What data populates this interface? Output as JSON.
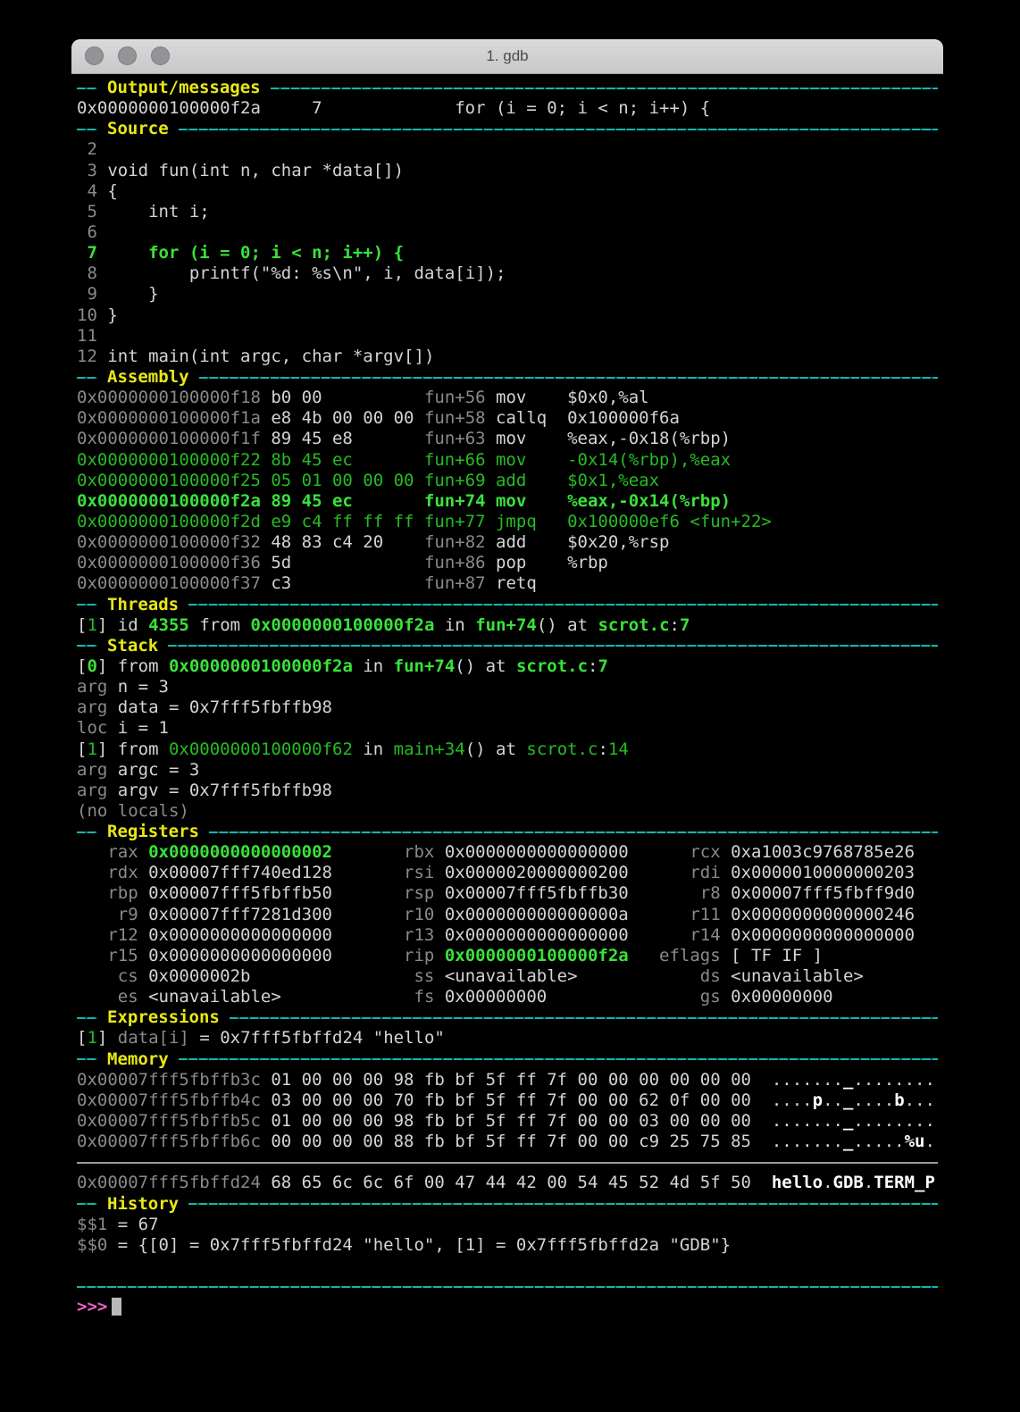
{
  "window": {
    "title": "1. gdb",
    "traffic_lights": [
      "close",
      "minimize",
      "zoom"
    ]
  },
  "colors": {
    "divider_cyan": "#14b5b0",
    "section_label_yellow": "#e8e815",
    "highlight_green": "#3ae23a",
    "green": "#25bc24",
    "dim_gray": "#8a8a8a",
    "text_white": "#d4d4d4",
    "prompt_magenta": "#ee63c8",
    "cursor_gray": "#b9b9b9",
    "memory_divider_gray": "#9c9c9c"
  },
  "terminal": {
    "prompt": ">>>",
    "lines": [
      {
        "type": "header",
        "name": "section-output-messages",
        "label": "Output/messages"
      },
      {
        "type": "text",
        "name": "output-line",
        "seg": [
          [
            "w",
            "0x0000000100000f2a     7             for (i = 0; i < n; i++) {"
          ]
        ]
      },
      {
        "type": "header",
        "name": "section-source",
        "label": "Source"
      },
      {
        "type": "text",
        "name": "source-line-2",
        "seg": [
          [
            "d",
            " 2"
          ]
        ]
      },
      {
        "type": "text",
        "name": "source-line-3",
        "seg": [
          [
            "d",
            " 3"
          ],
          [
            "w",
            " void fun(int n, char *data[])"
          ]
        ]
      },
      {
        "type": "text",
        "name": "source-line-4",
        "seg": [
          [
            "d",
            " 4"
          ],
          [
            "w",
            " {"
          ]
        ]
      },
      {
        "type": "text",
        "name": "source-line-5",
        "seg": [
          [
            "d",
            " 5"
          ],
          [
            "w",
            "     int i;"
          ]
        ]
      },
      {
        "type": "text",
        "name": "source-line-6",
        "seg": [
          [
            "d",
            " 6"
          ]
        ]
      },
      {
        "type": "text",
        "name": "source-line-7-current",
        "seg": [
          [
            "G",
            " 7     for (i = 0; i < n; i++) {"
          ]
        ]
      },
      {
        "type": "text",
        "name": "source-line-8",
        "seg": [
          [
            "d",
            " 8"
          ],
          [
            "w",
            "         printf(\"%d: %s\\n\", i, data[i]);"
          ]
        ]
      },
      {
        "type": "text",
        "name": "source-line-9",
        "seg": [
          [
            "d",
            " 9"
          ],
          [
            "w",
            "     }"
          ]
        ]
      },
      {
        "type": "text",
        "name": "source-line-10",
        "seg": [
          [
            "d",
            "10"
          ],
          [
            "w",
            " }"
          ]
        ]
      },
      {
        "type": "text",
        "name": "source-line-11",
        "seg": [
          [
            "d",
            "11"
          ]
        ]
      },
      {
        "type": "text",
        "name": "source-line-12",
        "seg": [
          [
            "d",
            "12"
          ],
          [
            "w",
            " int main(int argc, char *argv[])"
          ]
        ]
      },
      {
        "type": "header",
        "name": "section-assembly",
        "label": "Assembly"
      },
      {
        "type": "text",
        "name": "asm-line-fun56",
        "seg": [
          [
            "d",
            "0x0000000100000f18"
          ],
          [
            "w",
            " b0 00          "
          ],
          [
            "d",
            "fun+56"
          ],
          [
            "w",
            " mov    $0x0,%al"
          ]
        ]
      },
      {
        "type": "text",
        "name": "asm-line-fun58",
        "seg": [
          [
            "d",
            "0x0000000100000f1a"
          ],
          [
            "w",
            " e8 4b 00 00 00 "
          ],
          [
            "d",
            "fun+58"
          ],
          [
            "w",
            " callq  0x100000f6a"
          ]
        ]
      },
      {
        "type": "text",
        "name": "asm-line-fun63",
        "seg": [
          [
            "d",
            "0x0000000100000f1f"
          ],
          [
            "w",
            " 89 45 e8       "
          ],
          [
            "d",
            "fun+63"
          ],
          [
            "w",
            " mov    %eax,-0x18(%rbp)"
          ]
        ]
      },
      {
        "type": "text",
        "name": "asm-line-fun66",
        "seg": [
          [
            "g",
            "0x0000000100000f22 8b 45 ec       fun+66 mov    -0x14(%rbp),%eax"
          ]
        ]
      },
      {
        "type": "text",
        "name": "asm-line-fun69",
        "seg": [
          [
            "g",
            "0x0000000100000f25 05 01 00 00 00 fun+69 add    $0x1,%eax"
          ]
        ]
      },
      {
        "type": "text",
        "name": "asm-line-fun74-current",
        "seg": [
          [
            "G",
            "0x0000000100000f2a 89 45 ec       fun+74 mov    %eax,-0x14(%rbp)"
          ]
        ]
      },
      {
        "type": "text",
        "name": "asm-line-fun77",
        "seg": [
          [
            "g",
            "0x0000000100000f2d e9 c4 ff ff ff fun+77 jmpq   0x100000ef6 <fun+22>"
          ]
        ]
      },
      {
        "type": "text",
        "name": "asm-line-fun82",
        "seg": [
          [
            "d",
            "0x0000000100000f32"
          ],
          [
            "w",
            " 48 83 c4 20    "
          ],
          [
            "d",
            "fun+82"
          ],
          [
            "w",
            " add    $0x20,%rsp"
          ]
        ]
      },
      {
        "type": "text",
        "name": "asm-line-fun86",
        "seg": [
          [
            "d",
            "0x0000000100000f36"
          ],
          [
            "w",
            " 5d             "
          ],
          [
            "d",
            "fun+86"
          ],
          [
            "w",
            " pop    %rbp"
          ]
        ]
      },
      {
        "type": "text",
        "name": "asm-line-fun87",
        "seg": [
          [
            "d",
            "0x0000000100000f37"
          ],
          [
            "w",
            " c3             "
          ],
          [
            "d",
            "fun+87"
          ],
          [
            "w",
            " retq"
          ]
        ]
      },
      {
        "type": "header",
        "name": "section-threads",
        "label": "Threads"
      },
      {
        "type": "text",
        "name": "thread-1",
        "seg": [
          [
            "w",
            "["
          ],
          [
            "g",
            "1"
          ],
          [
            "w",
            "] id "
          ],
          [
            "G",
            "4355"
          ],
          [
            "w",
            " from "
          ],
          [
            "G",
            "0x0000000100000f2a"
          ],
          [
            "w",
            " in "
          ],
          [
            "G",
            "fun+74"
          ],
          [
            "w",
            "() at "
          ],
          [
            "G",
            "scrot.c"
          ],
          [
            "w",
            ":"
          ],
          [
            "G",
            "7"
          ]
        ]
      },
      {
        "type": "header",
        "name": "section-stack",
        "label": "Stack"
      },
      {
        "type": "text",
        "name": "stack-frame-0",
        "seg": [
          [
            "w",
            "["
          ],
          [
            "G",
            "0"
          ],
          [
            "w",
            "] from "
          ],
          [
            "G",
            "0x0000000100000f2a"
          ],
          [
            "w",
            " in "
          ],
          [
            "G",
            "fun+74"
          ],
          [
            "w",
            "() at "
          ],
          [
            "G",
            "scrot.c"
          ],
          [
            "w",
            ":"
          ],
          [
            "G",
            "7"
          ]
        ]
      },
      {
        "type": "text",
        "name": "stack-arg-n",
        "seg": [
          [
            "d",
            "arg"
          ],
          [
            "w",
            " n = 3"
          ]
        ]
      },
      {
        "type": "text",
        "name": "stack-arg-data",
        "seg": [
          [
            "d",
            "arg"
          ],
          [
            "w",
            " data = 0x7fff5fbffb98"
          ]
        ]
      },
      {
        "type": "text",
        "name": "stack-loc-i",
        "seg": [
          [
            "d",
            "loc"
          ],
          [
            "w",
            " i = 1"
          ]
        ]
      },
      {
        "type": "text",
        "name": "stack-frame-1",
        "seg": [
          [
            "w",
            "["
          ],
          [
            "g",
            "1"
          ],
          [
            "w",
            "] from "
          ],
          [
            "g",
            "0x0000000100000f62"
          ],
          [
            "w",
            " in "
          ],
          [
            "g",
            "main+34"
          ],
          [
            "w",
            "() at "
          ],
          [
            "g",
            "scrot.c"
          ],
          [
            "w",
            ":"
          ],
          [
            "g",
            "14"
          ]
        ]
      },
      {
        "type": "text",
        "name": "stack-arg-argc",
        "seg": [
          [
            "d",
            "arg"
          ],
          [
            "w",
            " argc = 3"
          ]
        ]
      },
      {
        "type": "text",
        "name": "stack-arg-argv",
        "seg": [
          [
            "d",
            "arg"
          ],
          [
            "w",
            " argv = 0x7fff5fbffb98"
          ]
        ]
      },
      {
        "type": "text",
        "name": "stack-no-locals",
        "seg": [
          [
            "d",
            "(no locals)"
          ]
        ]
      },
      {
        "type": "header",
        "name": "section-registers",
        "label": "Registers"
      },
      {
        "type": "text",
        "name": "reg-row-1",
        "seg": [
          [
            "d",
            "   rax "
          ],
          [
            "G",
            "0x0000000000000002"
          ],
          [
            "d",
            "       rbx "
          ],
          [
            "w",
            "0x0000000000000000"
          ],
          [
            "d",
            "      rcx "
          ],
          [
            "w",
            "0xa1003c9768785e26"
          ]
        ]
      },
      {
        "type": "text",
        "name": "reg-row-2",
        "seg": [
          [
            "d",
            "   rdx "
          ],
          [
            "w",
            "0x00007fff740ed128"
          ],
          [
            "d",
            "       rsi "
          ],
          [
            "w",
            "0x0000020000000200"
          ],
          [
            "d",
            "      rdi "
          ],
          [
            "w",
            "0x0000010000000203"
          ]
        ]
      },
      {
        "type": "text",
        "name": "reg-row-3",
        "seg": [
          [
            "d",
            "   rbp "
          ],
          [
            "w",
            "0x00007fff5fbffb50"
          ],
          [
            "d",
            "       rsp "
          ],
          [
            "w",
            "0x00007fff5fbffb30"
          ],
          [
            "d",
            "       r8 "
          ],
          [
            "w",
            "0x00007fff5fbff9d0"
          ]
        ]
      },
      {
        "type": "text",
        "name": "reg-row-4",
        "seg": [
          [
            "d",
            "    r9 "
          ],
          [
            "w",
            "0x00007fff7281d300"
          ],
          [
            "d",
            "       r10 "
          ],
          [
            "w",
            "0x000000000000000a"
          ],
          [
            "d",
            "      r11 "
          ],
          [
            "w",
            "0x0000000000000246"
          ]
        ]
      },
      {
        "type": "text",
        "name": "reg-row-5",
        "seg": [
          [
            "d",
            "   r12 "
          ],
          [
            "w",
            "0x0000000000000000"
          ],
          [
            "d",
            "       r13 "
          ],
          [
            "w",
            "0x0000000000000000"
          ],
          [
            "d",
            "      r14 "
          ],
          [
            "w",
            "0x0000000000000000"
          ]
        ]
      },
      {
        "type": "text",
        "name": "reg-row-6",
        "seg": [
          [
            "d",
            "   r15 "
          ],
          [
            "w",
            "0x0000000000000000"
          ],
          [
            "d",
            "       rip "
          ],
          [
            "G",
            "0x0000000100000f2a"
          ],
          [
            "d",
            "   eflags "
          ],
          [
            "w",
            "[ TF IF ]"
          ]
        ]
      },
      {
        "type": "text",
        "name": "reg-row-7",
        "seg": [
          [
            "d",
            "    cs "
          ],
          [
            "w",
            "0x0000002b"
          ],
          [
            "d",
            "                ss "
          ],
          [
            "w",
            "<unavailable>"
          ],
          [
            "d",
            "            ds "
          ],
          [
            "w",
            "<unavailable>"
          ]
        ]
      },
      {
        "type": "text",
        "name": "reg-row-8",
        "seg": [
          [
            "d",
            "    es "
          ],
          [
            "w",
            "<unavailable>"
          ],
          [
            "d",
            "             fs "
          ],
          [
            "w",
            "0x00000000"
          ],
          [
            "d",
            "               gs "
          ],
          [
            "w",
            "0x00000000"
          ]
        ]
      },
      {
        "type": "header",
        "name": "section-expressions",
        "label": "Expressions"
      },
      {
        "type": "text",
        "name": "expression-1",
        "seg": [
          [
            "w",
            "["
          ],
          [
            "g",
            "1"
          ],
          [
            "w",
            "] "
          ],
          [
            "d",
            "data[i]"
          ],
          [
            "w",
            " = 0x7fff5fbffd24 \"hello\""
          ]
        ]
      },
      {
        "type": "header",
        "name": "section-memory",
        "label": "Memory"
      },
      {
        "type": "text",
        "name": "memory-row-1",
        "seg": [
          [
            "d",
            "0x00007fff5fbffb3c"
          ],
          [
            "w",
            " 01 00 00 00 98 fb bf 5f ff 7f 00 00 00 00 00 00  "
          ],
          [
            "w",
            "......."
          ],
          [
            "b",
            "_"
          ],
          [
            "w",
            "........"
          ]
        ]
      },
      {
        "type": "text",
        "name": "memory-row-2",
        "seg": [
          [
            "d",
            "0x00007fff5fbffb4c"
          ],
          [
            "w",
            " 03 00 00 00 70 fb bf 5f ff 7f 00 00 62 0f 00 00  "
          ],
          [
            "w",
            "...."
          ],
          [
            "b",
            "p"
          ],
          [
            "w",
            ".."
          ],
          [
            "b",
            "_"
          ],
          [
            "w",
            "...."
          ],
          [
            "b",
            "b"
          ],
          [
            "w",
            "..."
          ]
        ]
      },
      {
        "type": "text",
        "name": "memory-row-3",
        "seg": [
          [
            "d",
            "0x00007fff5fbffb5c"
          ],
          [
            "w",
            " 01 00 00 00 98 fb bf 5f ff 7f 00 00 03 00 00 00  "
          ],
          [
            "w",
            "......."
          ],
          [
            "b",
            "_"
          ],
          [
            "w",
            "........"
          ]
        ]
      },
      {
        "type": "text",
        "name": "memory-row-4",
        "seg": [
          [
            "d",
            "0x00007fff5fbffb6c"
          ],
          [
            "w",
            " 00 00 00 00 88 fb bf 5f ff 7f 00 00 c9 25 75 85  "
          ],
          [
            "w",
            "......."
          ],
          [
            "b",
            "_"
          ],
          [
            "w",
            "....."
          ],
          [
            "b",
            "%u"
          ],
          [
            "w",
            "."
          ]
        ]
      },
      {
        "type": "rule",
        "name": "memory-region-divider",
        "color": "gray"
      },
      {
        "type": "text",
        "name": "memory-row-5",
        "seg": [
          [
            "d",
            "0x00007fff5fbffd24"
          ],
          [
            "w",
            " 68 65 6c 6c 6f 00 47 44 42 00 54 45 52 4d 5f 50  "
          ],
          [
            "b",
            "hello"
          ],
          [
            "w",
            "."
          ],
          [
            "b",
            "GDB"
          ],
          [
            "w",
            "."
          ],
          [
            "b",
            "TERM_P"
          ]
        ]
      },
      {
        "type": "header",
        "name": "section-history",
        "label": "History"
      },
      {
        "type": "text",
        "name": "history-1",
        "seg": [
          [
            "d",
            "$$1"
          ],
          [
            "w",
            " = 67"
          ]
        ]
      },
      {
        "type": "text",
        "name": "history-0",
        "seg": [
          [
            "d",
            "$$0"
          ],
          [
            "w",
            " = {[0] = 0x7fff5fbffd24 \"hello\", [1] = 0x7fff5fbffd2a \"GDB\"}"
          ]
        ]
      },
      {
        "type": "blank",
        "name": "blank-line"
      },
      {
        "type": "rule",
        "name": "prompt-divider",
        "color": "cyan"
      },
      {
        "type": "prompt",
        "name": "command-prompt"
      }
    ]
  }
}
